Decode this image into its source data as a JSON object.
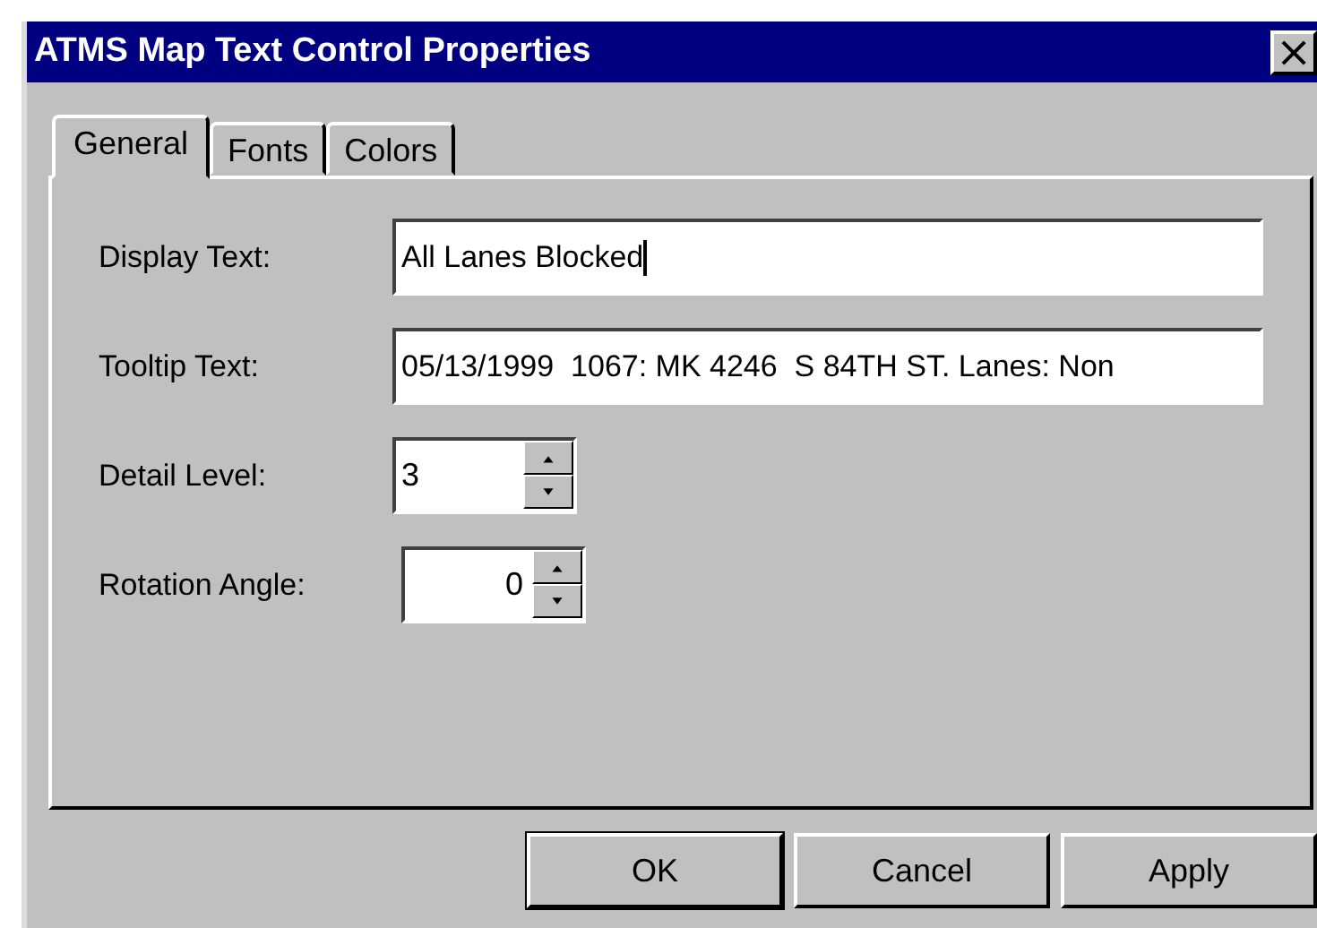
{
  "window": {
    "title": "ATMS Map Text Control Properties",
    "close": "×"
  },
  "tabs": [
    {
      "label": "General",
      "selected": true
    },
    {
      "label": "Fonts",
      "selected": false
    },
    {
      "label": "Colors",
      "selected": false
    }
  ],
  "fields": [
    {
      "kind": "text",
      "label": "Display Text:",
      "value": "All Lanes Blocked",
      "focused": true,
      "right_aligned": false
    },
    {
      "kind": "text",
      "label": "Tooltip Text:",
      "value": "05/13/1999  1067: MK 4246  S 84TH ST. Lanes: Non",
      "focused": false,
      "right_aligned": false
    },
    {
      "kind": "spin",
      "label": "Detail Level:",
      "value": "3",
      "focused": false,
      "right_aligned": false
    },
    {
      "kind": "spin",
      "label": "Rotation Angle:",
      "value": "0",
      "focused": false,
      "right_aligned": true
    }
  ],
  "buttons": [
    {
      "label": "OK",
      "default": true
    },
    {
      "label": "Cancel",
      "default": false
    },
    {
      "label": "Apply",
      "default": false
    }
  ]
}
